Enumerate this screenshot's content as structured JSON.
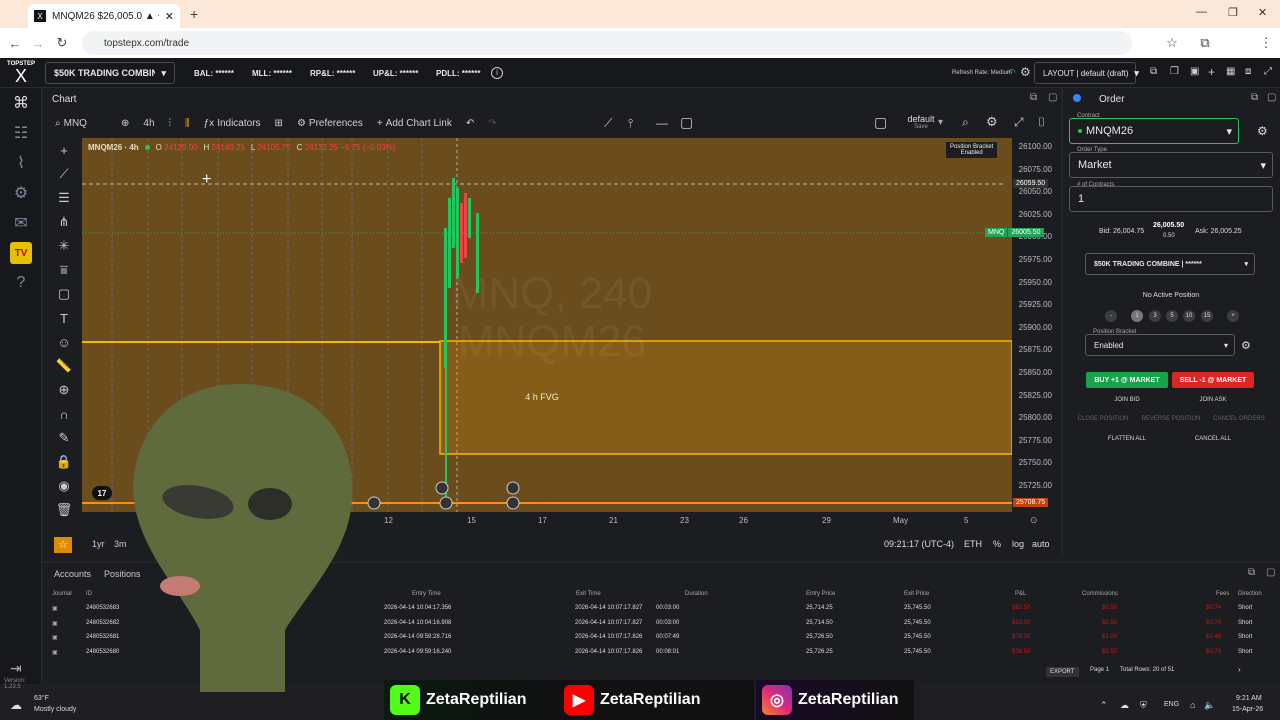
{
  "browser": {
    "tab_title": "MNQM26 $26,005.0 ▲ +0.03%",
    "url": "topstepx.com/trade"
  },
  "app": {
    "logo_text": "TOPSTEP",
    "account_selector": "$50K TRADING COMBINE | *...",
    "stats": {
      "bal": "BAL: ******",
      "mll": "MLL: ******",
      "rpl": "RP&L: ******",
      "upl": "UP&L: ******",
      "pdll": "PDLL: ******"
    },
    "refresh_rate": "Refresh Rate: Medium",
    "layout": "LAYOUT | default (draft)"
  },
  "chart": {
    "panel_title": "Chart",
    "symbol_search": "MNQ",
    "interval": "4h",
    "indicators_label": "Indicators",
    "preferences_label": "Preferences",
    "add_chart_link_label": "Add Chart Link",
    "layout_name": "default",
    "layout_sub": "Save",
    "legend_symbol": "MNQM26 · 4h",
    "legend_o": "O",
    "legend_h": "H",
    "legend_l": "L",
    "legend_c": "C",
    "legend_o_val": "24139.00",
    "legend_h_val": "24140.25",
    "legend_l_val": "24105.75",
    "legend_c_val": "24132.25 −6.75 (−0.03%)",
    "position_bracket": "Position Bracket",
    "position_bracket_sub": "Enabled",
    "watermark_1": "MNQ, 240",
    "watermark_2": "MNQM26",
    "fvg_label": "4 h FVG",
    "price_tag_symbol": "MNQ",
    "price_tag_value": "26005.50",
    "crosshair_value": "26059.50",
    "bottom_price": "25708.75",
    "y_ticks": [
      "26100.00",
      "26075.00",
      "26050.00",
      "26025.00",
      "26000.00",
      "25975.00",
      "25950.00",
      "25925.00",
      "25900.00",
      "25875.00",
      "25850.00",
      "25825.00",
      "25800.00",
      "25775.00",
      "25750.00",
      "25725.00"
    ],
    "x_ticks": [
      "12",
      "15",
      "17",
      "21",
      "23",
      "26",
      "29",
      "May",
      "5"
    ],
    "range_1y": "1yr",
    "range_3m": "3m",
    "clock": "09:21:17 (UTC-4)",
    "session": "ETH",
    "pct": "%",
    "log": "log",
    "auto": "auto"
  },
  "order": {
    "title": "Order",
    "contract_label": "Contract",
    "contract": "MNQM26",
    "order_type_label": "Order Type",
    "order_type": "Market",
    "contracts_label": "# of Contracts",
    "contracts": "1",
    "bid": "Bid: 26,004.75",
    "last": "26,005.50",
    "spread": "0.50",
    "ask": "Ask: 26,005.25",
    "account": "$50K TRADING COMBINE | ******",
    "no_position": "No Active Position",
    "qty_buttons": [
      "-",
      "1",
      "3",
      "5",
      "10",
      "15",
      "+"
    ],
    "bracket_label": "Position Bracket",
    "bracket_value": "Enabled",
    "buy": "BUY +1 @ MARKET",
    "sell": "SELL -1 @ MARKET",
    "join_bid": "JOIN BID",
    "join_ask": "JOIN ASK",
    "close_position": "CLOSE POSITION",
    "reverse_position": "REVERSE POSITION",
    "cancel_orders": "CANCEL ORDERS",
    "flatten_all": "FLATTEN ALL",
    "cancel_all": "CANCEL ALL"
  },
  "table": {
    "tabs": [
      "Accounts",
      "Positions"
    ],
    "headers": [
      "Journal",
      "ID",
      "Entry Time",
      "Exit Time",
      "Duration",
      "Entry Price",
      "Exit Price",
      "P&L",
      "Commissions",
      "Fees",
      "Direction"
    ],
    "rows": [
      {
        "id": "2480532683",
        "entry": "2026-04-14 10:04:17.356",
        "exit": "2026-04-14 10:07:17.827",
        "dur": "00:03:00",
        "ep": "25,714.25",
        "xp": "25,745.50",
        "pl": "$62.50",
        "comm": "$0.50",
        "fees": "$0.74",
        "dir": "Short",
        "n": ""
      },
      {
        "id": "2480532682",
        "entry": "2026-04-14 10:04:16.908",
        "exit": "2026-04-14 10:07:17.827",
        "dur": "00:03:00",
        "ep": "25,714.50",
        "xp": "25,745.50",
        "pl": "$62.00",
        "comm": "$0.50",
        "fees": "$0.74",
        "dir": "Short",
        "n": ""
      },
      {
        "id": "2480532681",
        "entry": "2026-04-14 09:59:28.716",
        "exit": "2026-04-14 10:07:17.826",
        "dur": "00:07:49",
        "ep": "25,726.50",
        "xp": "25,745.50",
        "pl": "$76.00",
        "comm": "$1.00",
        "fees": "$1.48",
        "dir": "Short",
        "n": "2"
      },
      {
        "id": "2480532680",
        "entry": "2026-04-14 09:59:16.240",
        "exit": "2026-04-14 10:07:17.826",
        "dur": "00:08:01",
        "ep": "25,726.25",
        "xp": "25,745.50",
        "pl": "$38.50",
        "comm": "$0.50",
        "fees": "$0.74",
        "dir": "Short",
        "n": "1"
      }
    ],
    "export": "EXPORT",
    "page": "Page 1",
    "total_rows": "Total Rows: 20 of 51"
  },
  "footer": {
    "version": "Version: 1.23.5"
  },
  "taskbar": {
    "weather_temp": "63°F",
    "weather_desc": "Mostly cloudy",
    "lang": "ENG",
    "time": "9:21 AM",
    "date": "15-Apr-26"
  },
  "social": {
    "name": "ZetaReptilian"
  },
  "colors": {
    "buy": "#16a34a",
    "sell": "#dc2626",
    "accent": "#f59e0b",
    "fvg_border": "#f5b800",
    "price_tag": "#22a35a"
  }
}
